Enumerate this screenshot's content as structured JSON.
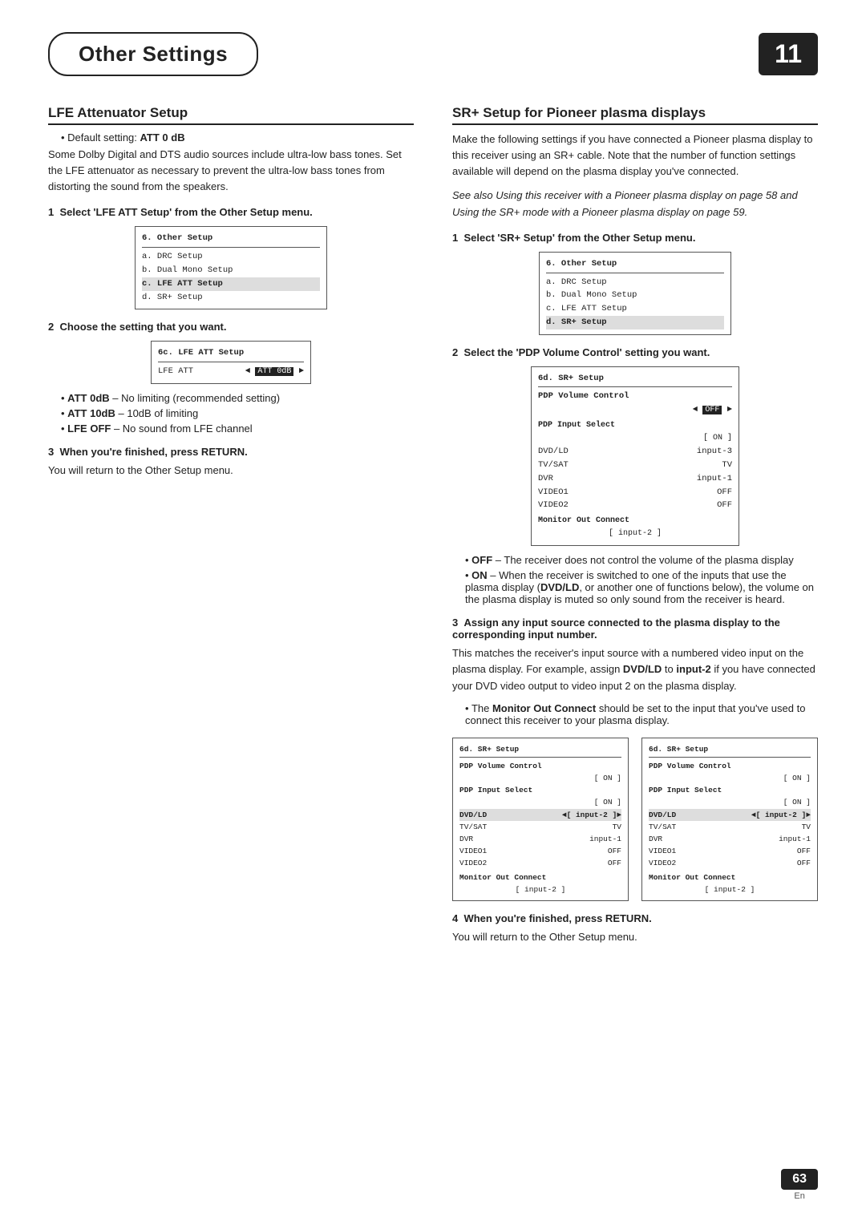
{
  "header": {
    "title": "Other Settings",
    "page_number": "11",
    "chapter_num": "63",
    "lang": "En"
  },
  "left_col": {
    "section_title": "LFE Attenuator Setup",
    "default_note": "Default setting: ATT 0 dB",
    "intro_text": "Some Dolby Digital and DTS audio sources include ultra-low bass tones. Set the LFE attenuator as necessary to prevent the ultra-low bass tones from distorting the sound from the speakers.",
    "step1": {
      "label": "1",
      "text": "Select 'LFE ATT Setup' from the Other Setup menu."
    },
    "screen1": {
      "title": "6. Other Setup",
      "items": [
        {
          "label": "a. DRC Setup",
          "selected": false
        },
        {
          "label": "b. Dual Mono Setup",
          "selected": false
        },
        {
          "label": "c. LFE ATT Setup",
          "selected": true
        },
        {
          "label": "d. SR+ Setup",
          "selected": false
        }
      ]
    },
    "step2": {
      "label": "2",
      "text": "Choose the setting that you want."
    },
    "screen2": {
      "title": "6c. LFE ATT Setup",
      "row_label": "LFE ATT",
      "row_value": "ATT 0dB"
    },
    "bullets": [
      {
        "text": "ATT 0dB",
        "bold_part": "ATT 0dB",
        "rest": " – No limiting (recommended setting)"
      },
      {
        "text": "ATT 10dB",
        "bold_part": "ATT 10dB",
        "rest": " – 10dB of limiting"
      },
      {
        "text": "LFE OFF",
        "bold_part": "LFE OFF",
        "rest": " – No sound from LFE channel"
      }
    ],
    "step3": {
      "label": "3",
      "text": "When you're finished, press RETURN."
    },
    "step3_sub": "You will return to the Other Setup menu."
  },
  "right_col": {
    "section_title": "SR+ Setup for Pioneer plasma displays",
    "intro_text": "Make the following settings if you have connected a Pioneer plasma display to this receiver using an SR+ cable. Note that the number of function settings available will depend on the plasma display you've connected.",
    "italic_note": "See also Using this receiver with a Pioneer plasma display on page 58 and Using the SR+ mode with a Pioneer plasma display on page 59.",
    "step1": {
      "label": "1",
      "text": "Select 'SR+ Setup' from the Other Setup menu."
    },
    "screen1": {
      "title": "6. Other Setup",
      "items": [
        {
          "label": "a. DRC Setup",
          "selected": false
        },
        {
          "label": "b. Dual Mono Setup",
          "selected": false
        },
        {
          "label": "c. LFE ATT Setup",
          "selected": false
        },
        {
          "label": "d. SR+ Setup",
          "selected": true
        }
      ]
    },
    "step2": {
      "label": "2",
      "text": "Select the 'PDP Volume Control' setting you want."
    },
    "screen3": {
      "title": "6d. SR+ Setup",
      "subtitle": "PDP Volume Control",
      "value_row": "OFF",
      "pdp_label": "PDP Input Select",
      "pdp_on": "[ ON ]",
      "rows": [
        {
          "label": "DVD/LD",
          "value": "input-3"
        },
        {
          "label": "TV/SAT",
          "value": "TV"
        },
        {
          "label": "DVR",
          "value": "input-1"
        },
        {
          "label": "VIDEO1",
          "value": "OFF"
        },
        {
          "label": "VIDEO2",
          "value": "OFF"
        }
      ],
      "monitor_label": "Monitor Out Connect",
      "monitor_value": "[ input-2 ]"
    },
    "bullet_off": {
      "bold_part": "OFF",
      "rest": " – The receiver does not control the volume of the plasma display"
    },
    "bullet_on": {
      "bold_part": "ON",
      "rest": " – When the receiver is switched to one of the inputs that use the plasma display (DVD/LD, or another one of functions below), the volume on the plasma display is muted so only sound from the receiver is heard."
    },
    "step3": {
      "label": "3",
      "heading": "Assign any input source connected to the plasma display to the corresponding input number.",
      "text": "This matches the receiver's input source with a numbered video input on the plasma display. For example, assign DVD/LD to input-2 if you have connected your DVD video output to video input 2 on the plasma display."
    },
    "bullet_monitor": {
      "bold_part": "Monitor Out Connect",
      "rest": " should be set to the input that you've used to connect this receiver to your plasma display."
    },
    "dual_screens": {
      "screen_a": {
        "title": "6d. SR+ Setup",
        "subtitle": "PDP Volume Control",
        "on_label": "[ ON ]",
        "pdp_label": "PDP Input Select",
        "pdp_bracket": "[ ON ]",
        "rows": [
          {
            "label": "DVD/LD",
            "value": "◄[ input-2 ]►",
            "selected": true
          },
          {
            "label": "TV/SAT",
            "value": "TV"
          },
          {
            "label": "DVR",
            "value": "input-1"
          },
          {
            "label": "VIDEO1",
            "value": "OFF"
          },
          {
            "label": "VIDEO2",
            "value": "OFF"
          }
        ],
        "monitor_label": "Monitor Out Connect",
        "monitor_value": "[ input-2 ]"
      },
      "screen_b": {
        "title": "6d. SR+ Setup",
        "subtitle": "PDP Volume Control",
        "on_label": "[ ON ]",
        "pdp_label": "PDP Input Select",
        "pdp_bracket": "[ ON ]",
        "rows": [
          {
            "label": "DVD/LD",
            "value": "◄[ input-2 ]►",
            "selected": true
          },
          {
            "label": "TV/SAT",
            "value": "TV"
          },
          {
            "label": "DVR",
            "value": "input-1"
          },
          {
            "label": "VIDEO1",
            "value": "OFF"
          },
          {
            "label": "VIDEO2",
            "value": "OFF"
          }
        ],
        "monitor_label": "Monitor Out Connect",
        "monitor_value": "[ input-2 ]"
      }
    },
    "step4": {
      "label": "4",
      "text": "When you're finished, press RETURN."
    },
    "step4_sub": "You will return to the Other Setup menu."
  }
}
